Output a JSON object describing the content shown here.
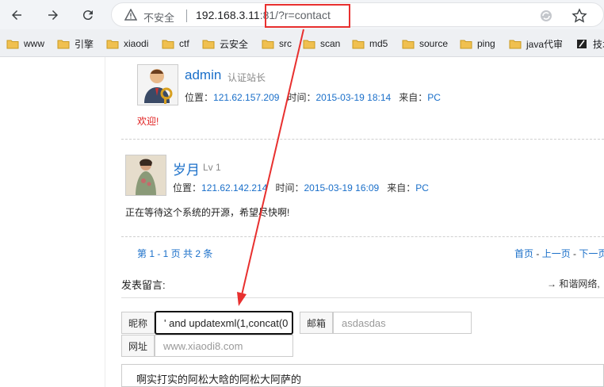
{
  "browser": {
    "security_label": "不安全",
    "url_host": "192.168.3.11",
    "url_rest": ":81/?r=contact"
  },
  "bookmarks": [
    {
      "label": "www"
    },
    {
      "label": "引擎"
    },
    {
      "label": "xiaodi"
    },
    {
      "label": "ctf"
    },
    {
      "label": "云安全"
    },
    {
      "label": "src"
    },
    {
      "label": "scan"
    },
    {
      "label": "md5"
    },
    {
      "label": "source"
    },
    {
      "label": "ping"
    },
    {
      "label": "java代审"
    },
    {
      "label": "技术"
    }
  ],
  "comments": [
    {
      "name": "admin",
      "role": "认证站长",
      "location_label": "位置：",
      "location": "121.62.157.209",
      "time_label": "时间：",
      "time": "2015-03-19 18:14",
      "source_label": "来自：",
      "source": "PC",
      "message": "欢迎!"
    },
    {
      "name": "岁月",
      "role": "Lv 1",
      "location_label": "位置：",
      "location": "121.62.142.214",
      "time_label": "时间：",
      "time": "2015-03-19 16:09",
      "source_label": "来自：",
      "source": "PC",
      "message": "正在等待这个系统的开源，希望尽快啊!"
    }
  ],
  "pager": {
    "summary": "第 1 - 1 页 共 2 条",
    "first": "首页",
    "prev": "上一页",
    "next": "下一页"
  },
  "form": {
    "title": "发表留言:",
    "note": "→ 和谐网络,",
    "nickname_label": "昵称",
    "nickname_value": "' and updatexml(1,concat(0",
    "email_label": "邮箱",
    "email_value": "asdasdas",
    "website_label": "网址",
    "website_placeholder": "www.xiaodi8.com",
    "content_value": "啊实打实的阿松大晗的阿松大阿萨的"
  },
  "colors": {
    "link": "#1a6fc9",
    "highlight": "#e8302f",
    "alert_text": "#e02020"
  }
}
